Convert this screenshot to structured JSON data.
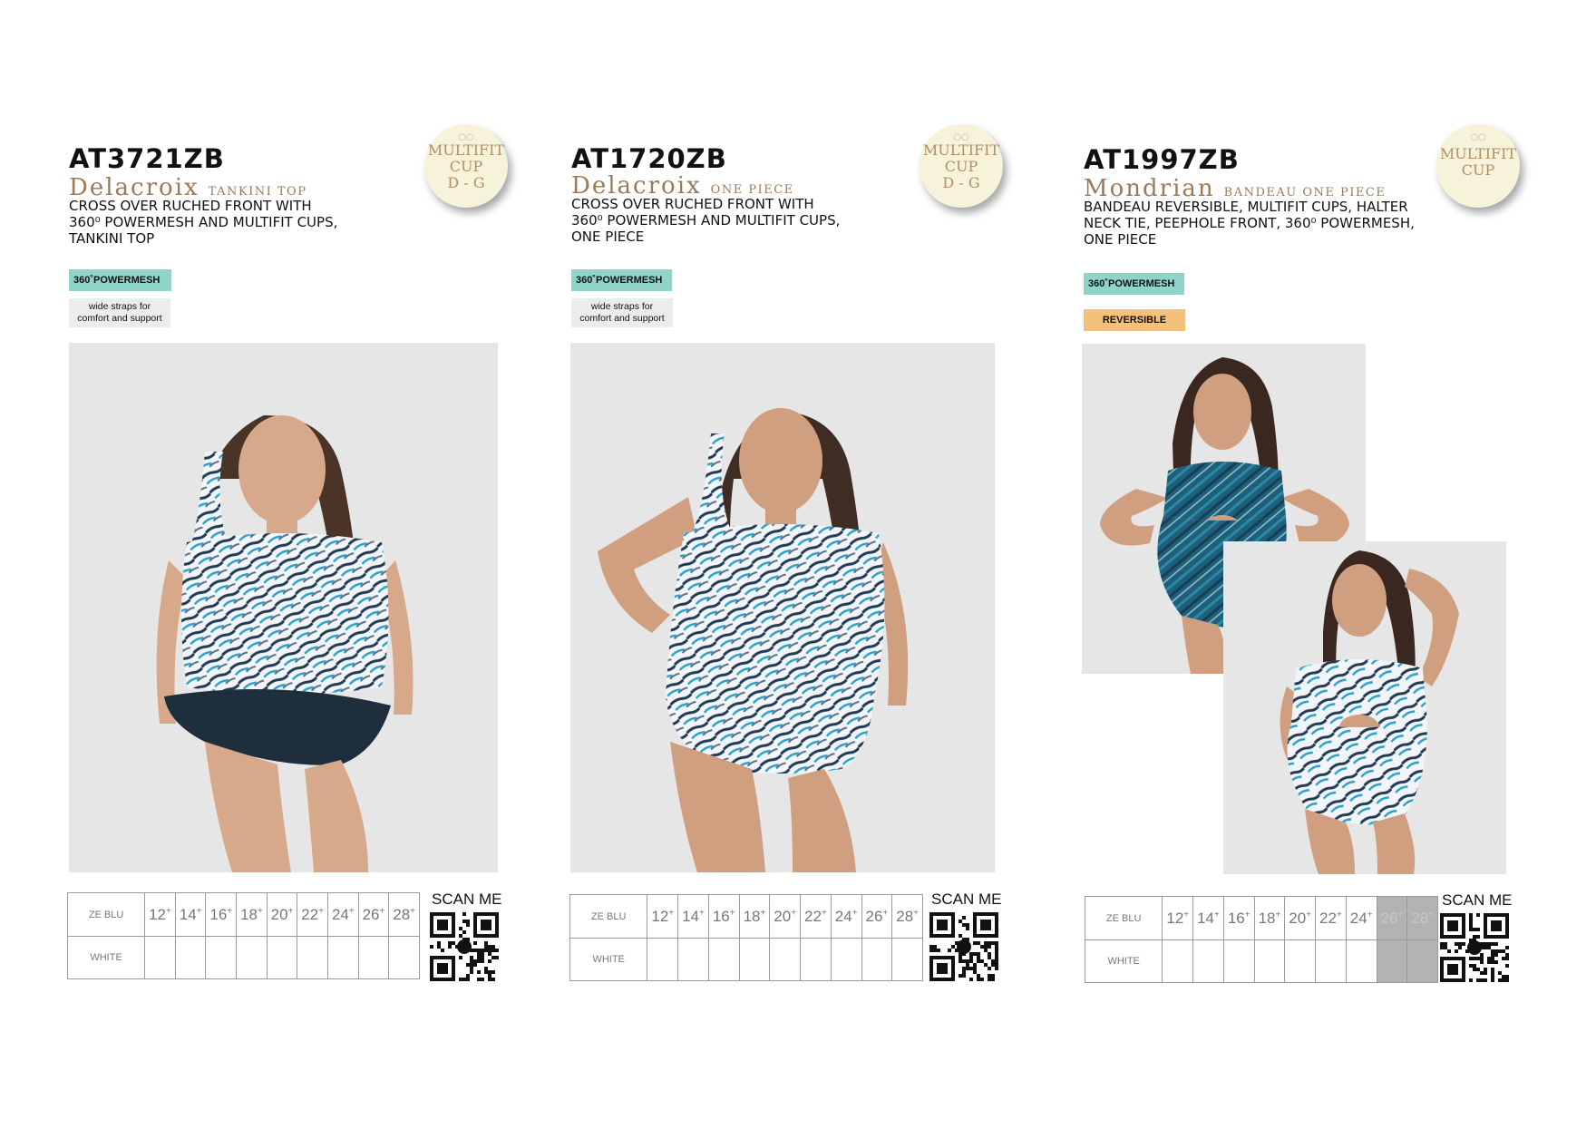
{
  "products": [
    {
      "sku": "AT3721ZB",
      "name": "Delacroix",
      "type": "TANKINI TOP",
      "description_lines": [
        "CROSS OVER RUCHED FRONT WITH",
        "360⁰ POWERMESH AND MULTIFIT CUPS,",
        "TANKINI TOP"
      ],
      "badge": {
        "rings": "○○",
        "lines": [
          "MULTIFIT",
          "CUP",
          "D - G"
        ]
      },
      "tags": {
        "powermesh": "360˚POWERMESH",
        "note_line1": "wide straps for",
        "note_line2": "comfort and support"
      },
      "colours": [
        "ZE BLU",
        "WHITE"
      ],
      "sizes": [
        "12",
        "14",
        "16",
        "18",
        "20",
        "22",
        "24",
        "26",
        "28"
      ],
      "unavailable_sizes": [],
      "scan_label": "SCAN ME"
    },
    {
      "sku": "AT1720ZB",
      "name": "Delacroix",
      "type": "ONE PIECE",
      "description_lines": [
        "CROSS OVER RUCHED FRONT WITH",
        "360⁰ POWERMESH AND MULTIFIT CUPS,",
        "ONE PIECE"
      ],
      "badge": {
        "rings": "○○",
        "lines": [
          "MULTIFIT",
          "CUP",
          "D - G"
        ]
      },
      "tags": {
        "powermesh": "360˚POWERMESH",
        "note_line1": "wide straps for",
        "note_line2": "comfort and support"
      },
      "colours": [
        "ZE BLU",
        "WHITE"
      ],
      "sizes": [
        "12",
        "14",
        "16",
        "18",
        "20",
        "22",
        "24",
        "26",
        "28"
      ],
      "unavailable_sizes": [],
      "scan_label": "SCAN ME"
    },
    {
      "sku": "AT1997ZB",
      "name": "Mondrian",
      "type": "BANDEAU ONE PIECE",
      "description_lines": [
        "BANDEAU REVERSIBLE, MULTIFIT CUPS, HALTER",
        "NECK TIE, PEEPHOLE FRONT, 360⁰ POWERMESH,",
        "ONE PIECE"
      ],
      "badge": {
        "rings": "○○",
        "lines": [
          "MULTIFIT",
          "CUP"
        ]
      },
      "tags": {
        "powermesh": "360˚POWERMESH",
        "reversible": "REVERSIBLE"
      },
      "colours": [
        "ZE BLU",
        "WHITE"
      ],
      "sizes": [
        "12",
        "14",
        "16",
        "18",
        "20",
        "22",
        "24",
        "26",
        "28"
      ],
      "unavailable_sizes": [
        "26",
        "28"
      ],
      "scan_label": "SCAN ME"
    }
  ],
  "colors": {
    "powermesh_tag": "#8fd3c9",
    "reversible_tag": "#f4c07c",
    "brand_brown": "#9b7a5a",
    "photo_bg": "#e6e6e6",
    "badge_bg": "#f6f3da"
  }
}
